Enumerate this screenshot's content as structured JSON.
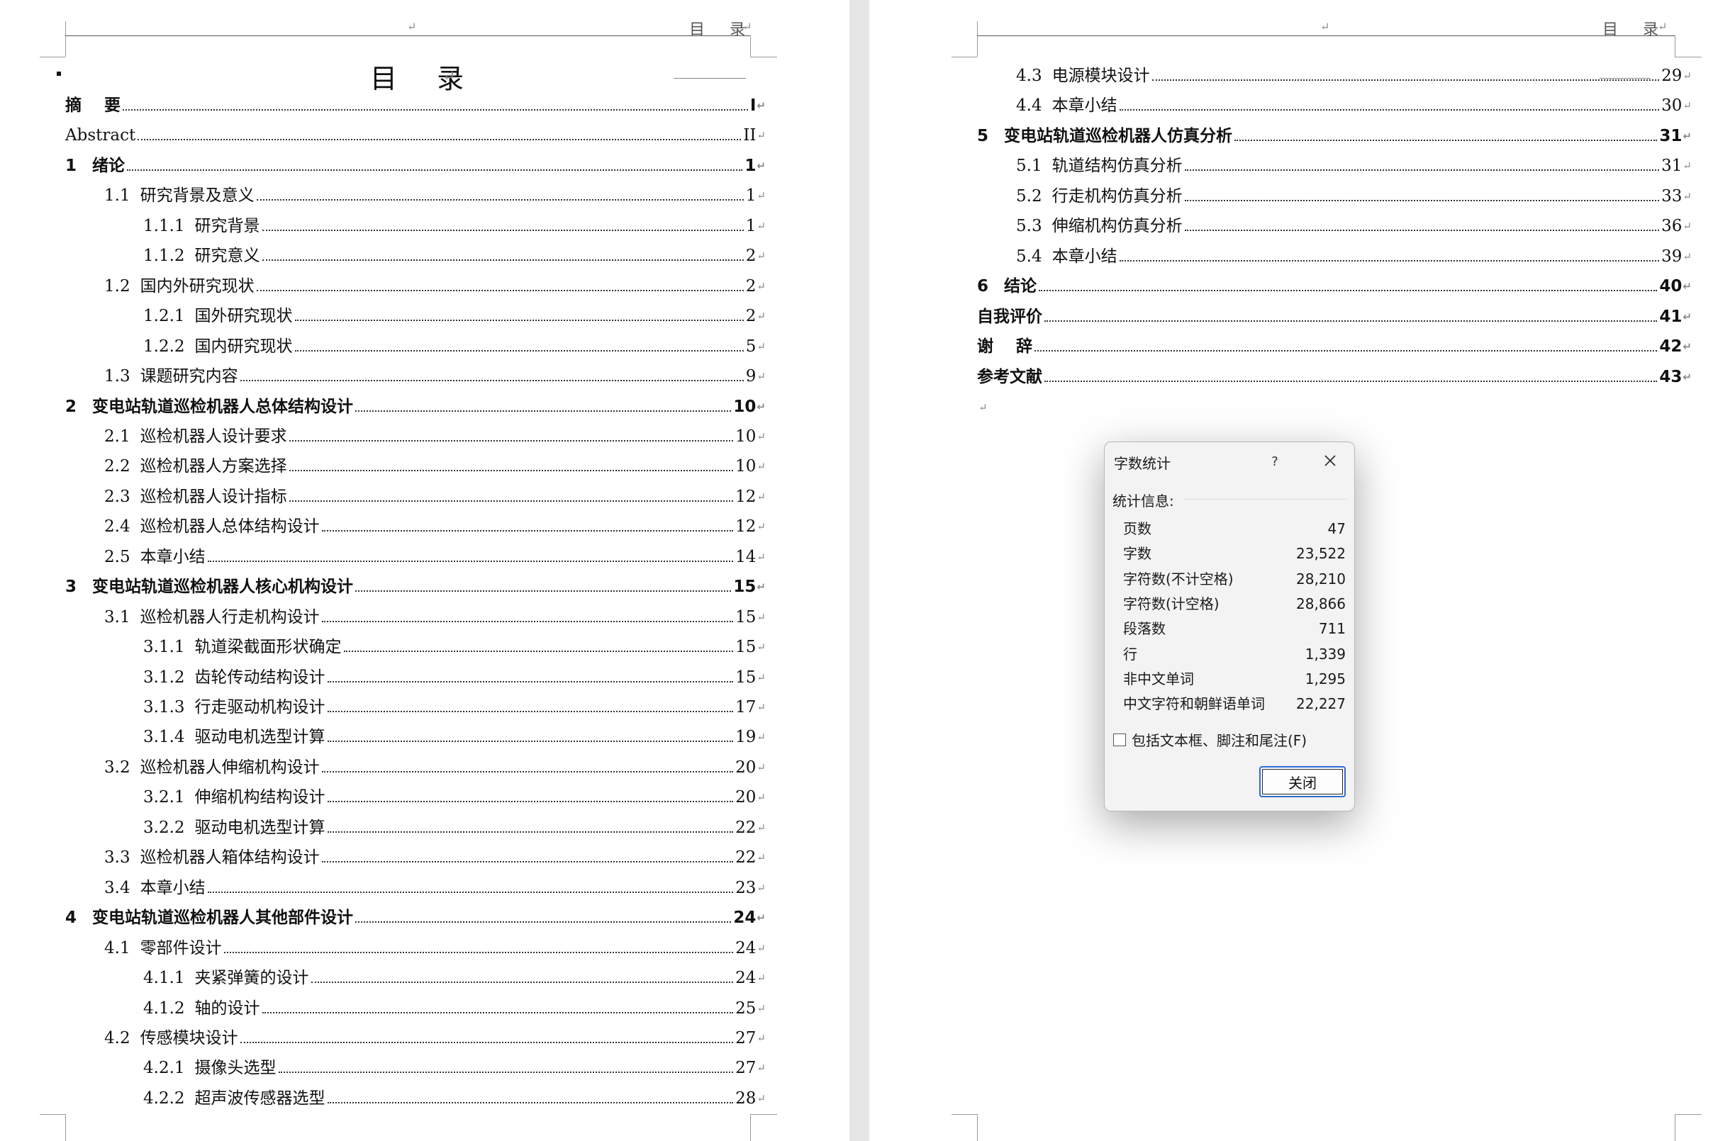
{
  "header": {
    "text": "目  录",
    "mark": "↵"
  },
  "toc_title": "目  录",
  "return_mark": "↵",
  "left_entries": [
    {
      "num": "",
      "text": "摘    要",
      "page": "I",
      "level": 0,
      "bold": true
    },
    {
      "num": "",
      "text": "Abstract",
      "page": "II",
      "level": 0,
      "bold": false
    },
    {
      "num": "1",
      "text": "绪论",
      "page": "1",
      "level": 0,
      "bold": true
    },
    {
      "num": "1.1",
      "text": "研究背景及意义",
      "page": "1",
      "level": 1,
      "bold": false
    },
    {
      "num": "1.1.1",
      "text": "研究背景",
      "page": "1",
      "level": 2,
      "bold": false
    },
    {
      "num": "1.1.2",
      "text": "研究意义",
      "page": "2",
      "level": 2,
      "bold": false
    },
    {
      "num": "1.2",
      "text": "国内外研究现状",
      "page": "2",
      "level": 1,
      "bold": false
    },
    {
      "num": "1.2.1",
      "text": "国外研究现状",
      "page": "2",
      "level": 2,
      "bold": false
    },
    {
      "num": "1.2.2",
      "text": "国内研究现状",
      "page": "5",
      "level": 2,
      "bold": false
    },
    {
      "num": "1.3",
      "text": "课题研究内容",
      "page": "9",
      "level": 1,
      "bold": false
    },
    {
      "num": "2",
      "text": "变电站轨道巡检机器人总体结构设计",
      "page": "10",
      "level": 0,
      "bold": true
    },
    {
      "num": "2.1",
      "text": "巡检机器人设计要求",
      "page": "10",
      "level": 1,
      "bold": false
    },
    {
      "num": "2.2",
      "text": "巡检机器人方案选择",
      "page": "10",
      "level": 1,
      "bold": false
    },
    {
      "num": "2.3",
      "text": "巡检机器人设计指标",
      "page": "12",
      "level": 1,
      "bold": false
    },
    {
      "num": "2.4",
      "text": "巡检机器人总体结构设计",
      "page": "12",
      "level": 1,
      "bold": false
    },
    {
      "num": "2.5",
      "text": "本章小结",
      "page": "14",
      "level": 1,
      "bold": false
    },
    {
      "num": "3",
      "text": "变电站轨道巡检机器人核心机构设计",
      "page": "15",
      "level": 0,
      "bold": true
    },
    {
      "num": "3.1",
      "text": "巡检机器人行走机构设计",
      "page": "15",
      "level": 1,
      "bold": false
    },
    {
      "num": "3.1.1",
      "text": "轨道梁截面形状确定",
      "page": "15",
      "level": 2,
      "bold": false
    },
    {
      "num": "3.1.2",
      "text": "齿轮传动结构设计",
      "page": "15",
      "level": 2,
      "bold": false
    },
    {
      "num": "3.1.3",
      "text": "行走驱动机构设计",
      "page": "17",
      "level": 2,
      "bold": false
    },
    {
      "num": "3.1.4",
      "text": "驱动电机选型计算",
      "page": "19",
      "level": 2,
      "bold": false
    },
    {
      "num": "3.2",
      "text": "巡检机器人伸缩机构设计",
      "page": "20",
      "level": 1,
      "bold": false
    },
    {
      "num": "3.2.1",
      "text": "伸缩机构结构设计",
      "page": "20",
      "level": 2,
      "bold": false
    },
    {
      "num": "3.2.2",
      "text": "驱动电机选型计算",
      "page": "22",
      "level": 2,
      "bold": false
    },
    {
      "num": "3.3",
      "text": "巡检机器人箱体结构设计",
      "page": "22",
      "level": 1,
      "bold": false
    },
    {
      "num": "3.4",
      "text": "本章小结",
      "page": "23",
      "level": 1,
      "bold": false
    },
    {
      "num": "4",
      "text": "变电站轨道巡检机器人其他部件设计",
      "page": "24",
      "level": 0,
      "bold": true
    },
    {
      "num": "4.1",
      "text": "零部件设计",
      "page": "24",
      "level": 1,
      "bold": false
    },
    {
      "num": "4.1.1",
      "text": "夹紧弹簧的设计",
      "page": "24",
      "level": 2,
      "bold": false
    },
    {
      "num": "4.1.2",
      "text": "轴的设计",
      "page": "25",
      "level": 2,
      "bold": false
    },
    {
      "num": "4.2",
      "text": "传感模块设计",
      "page": "27",
      "level": 1,
      "bold": false
    },
    {
      "num": "4.2.1",
      "text": "摄像头选型",
      "page": "27",
      "level": 2,
      "bold": false
    },
    {
      "num": "4.2.2",
      "text": "超声波传感器选型",
      "page": "28",
      "level": 2,
      "bold": false
    }
  ],
  "right_entries": [
    {
      "num": "4.3",
      "text": "电源模块设计",
      "page": "29",
      "level": 1,
      "bold": false
    },
    {
      "num": "4.4",
      "text": "本章小结",
      "page": "30",
      "level": 1,
      "bold": false
    },
    {
      "num": "5",
      "text": "变电站轨道巡检机器人仿真分析",
      "page": "31",
      "level": 0,
      "bold": true
    },
    {
      "num": "5.1",
      "text": "轨道结构仿真分析",
      "page": "31",
      "level": 1,
      "bold": false
    },
    {
      "num": "5.2",
      "text": "行走机构仿真分析",
      "page": "33",
      "level": 1,
      "bold": false
    },
    {
      "num": "5.3",
      "text": "伸缩机构仿真分析",
      "page": "36",
      "level": 1,
      "bold": false
    },
    {
      "num": "5.4",
      "text": "本章小结",
      "page": "39",
      "level": 1,
      "bold": false
    },
    {
      "num": "6",
      "text": "结论",
      "page": "40",
      "level": 0,
      "bold": true
    },
    {
      "num": "",
      "text": "自我评价",
      "page": "41",
      "level": 0,
      "bold": true
    },
    {
      "num": "",
      "text": "谢    辞",
      "page": "42",
      "level": 0,
      "bold": true
    },
    {
      "num": "",
      "text": "参考文献",
      "page": "43",
      "level": 0,
      "bold": true
    }
  ],
  "dialog": {
    "title": "字数统计",
    "help": "?",
    "section": "统计信息:",
    "stats": [
      {
        "label": "页数",
        "value": "47"
      },
      {
        "label": "字数",
        "value": "23,522"
      },
      {
        "label": "字符数(不计空格)",
        "value": "28,210"
      },
      {
        "label": "字符数(计空格)",
        "value": "28,866"
      },
      {
        "label": "段落数",
        "value": "711"
      },
      {
        "label": "行",
        "value": "1,339"
      },
      {
        "label": "非中文单词",
        "value": "1,295"
      },
      {
        "label": "中文字符和朝鲜语单词",
        "value": "22,227"
      }
    ],
    "checkbox_label": "包括文本框、脚注和尾注(F)",
    "checkbox_checked": false,
    "close_label": "关闭"
  }
}
